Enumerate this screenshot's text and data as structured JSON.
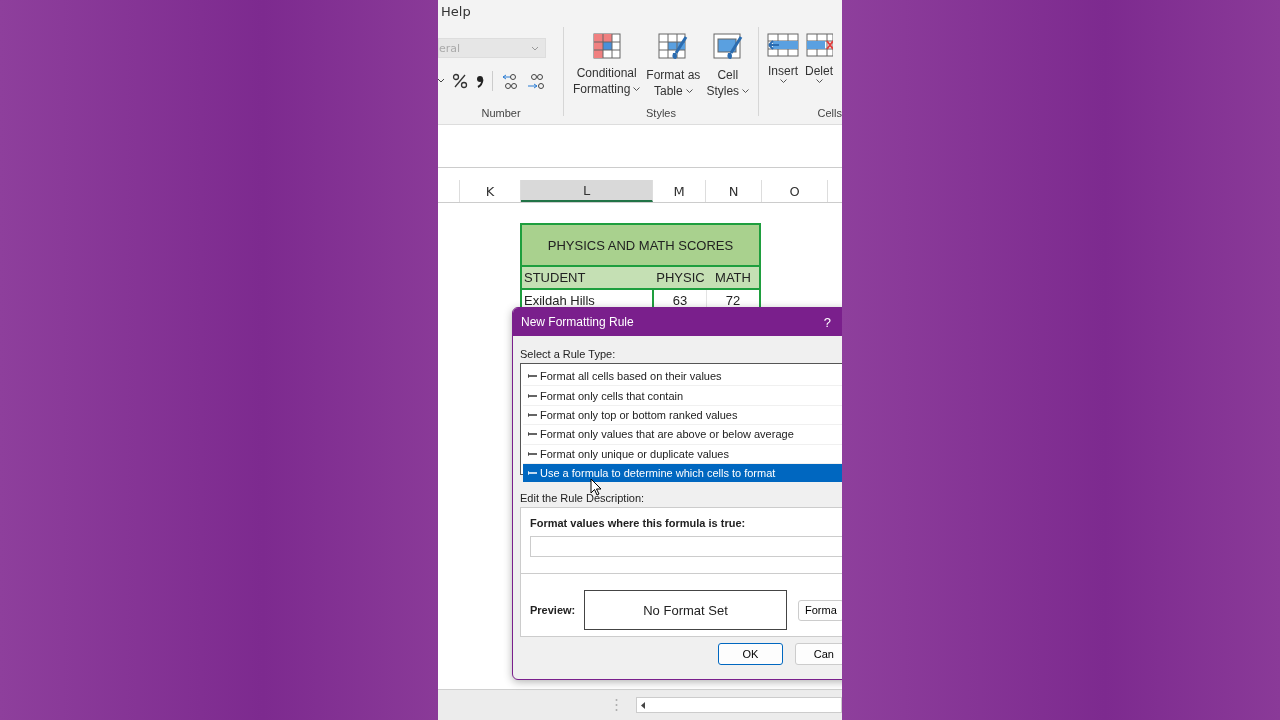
{
  "ribbon": {
    "tab": "Help",
    "number_group": {
      "format_box": "eral",
      "label": "Number"
    },
    "styles_group": {
      "buttons": [
        {
          "kind": "conditional",
          "line1": "Conditional",
          "line2": "Formatting"
        },
        {
          "kind": "table",
          "line1": "Format as",
          "line2": "Table"
        },
        {
          "kind": "cellstyle",
          "line1": "Cell",
          "line2": "Styles"
        }
      ],
      "label": "Styles"
    },
    "cells_group": {
      "buttons": [
        {
          "kind": "insert",
          "line1": "Insert"
        },
        {
          "kind": "delete",
          "line1": "Delet"
        }
      ],
      "label": "Cells"
    }
  },
  "sheet": {
    "columns": [
      {
        "label": "K",
        "selected": false
      },
      {
        "label": "L",
        "selected": true
      },
      {
        "label": "M",
        "selected": false
      },
      {
        "label": "N",
        "selected": false
      },
      {
        "label": "O",
        "selected": false
      }
    ],
    "table": {
      "title": "PHYSICS AND MATH SCORES",
      "headers": [
        "STUDENT",
        "PHYSIC",
        "MATH"
      ],
      "rows": [
        [
          "Exildah Hills",
          "63",
          "72"
        ]
      ]
    }
  },
  "dialog": {
    "title": "New Formatting Rule",
    "help": "?",
    "rule_type_label": "Select a Rule Type:",
    "rule_types": [
      {
        "label": "Format all cells based on their values",
        "selected": false
      },
      {
        "label": "Format only cells that contain",
        "selected": false
      },
      {
        "label": "Format only top or bottom ranked values",
        "selected": false
      },
      {
        "label": "Format only values that are above or below average",
        "selected": false
      },
      {
        "label": "Format only unique or duplicate values",
        "selected": false
      },
      {
        "label": "Use a formula to determine which cells to format",
        "selected": true
      }
    ],
    "description_label": "Edit the Rule Description:",
    "formula_label": "Format values where this formula is true:",
    "preview_label": "Preview:",
    "preview_text": "No Format Set",
    "format_button": "Forma",
    "ok": "OK",
    "cancel": "Can"
  }
}
